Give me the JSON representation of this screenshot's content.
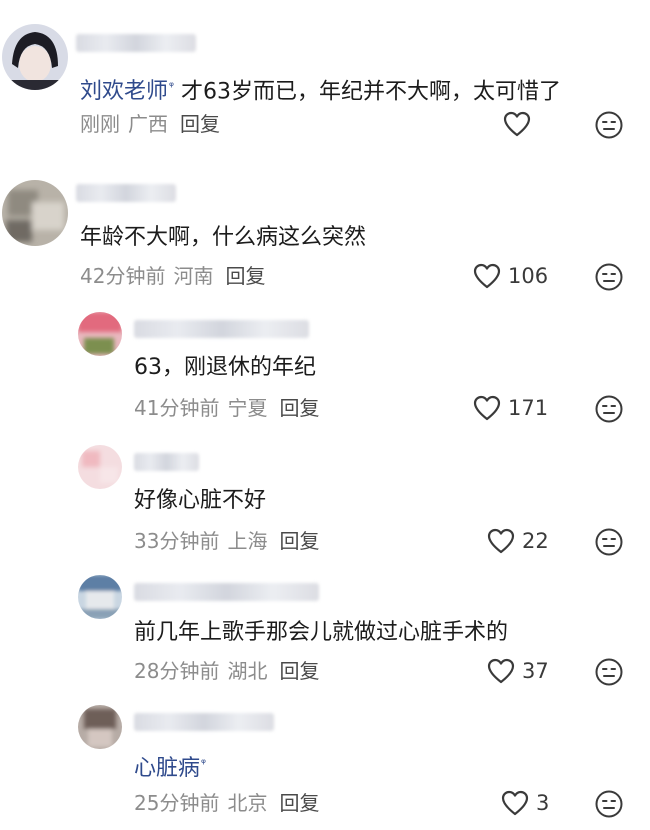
{
  "comments": [
    {
      "author": "刘欢老师",
      "text": "才63岁而已，年纪并不大啊，太可惜了",
      "time": "刚刚",
      "location": "广西",
      "reply_label": "回复",
      "likes": ""
    },
    {
      "text": "年龄不大啊，什么病这么突然",
      "time": "42分钟前",
      "location": "河南",
      "reply_label": "回复",
      "likes": "106"
    },
    {
      "text": "63，刚退休的年纪",
      "time": "41分钟前",
      "location": "宁夏",
      "reply_label": "回复",
      "likes": "171"
    },
    {
      "text": "好像心脏不好",
      "time": "33分钟前",
      "location": "上海",
      "reply_label": "回复",
      "likes": "22"
    },
    {
      "text": "前几年上歌手那会儿就做过心脏手术的",
      "time": "28分钟前",
      "location": "湖北",
      "reply_label": "回复",
      "likes": "37"
    },
    {
      "text": "心脏病",
      "time": "25分钟前",
      "location": "北京",
      "reply_label": "回复",
      "likes": "3"
    }
  ],
  "icons": {
    "like": "heart-outline-icon",
    "dislike": "neutral-face-icon",
    "mention": "magnifier-mention-icon"
  }
}
